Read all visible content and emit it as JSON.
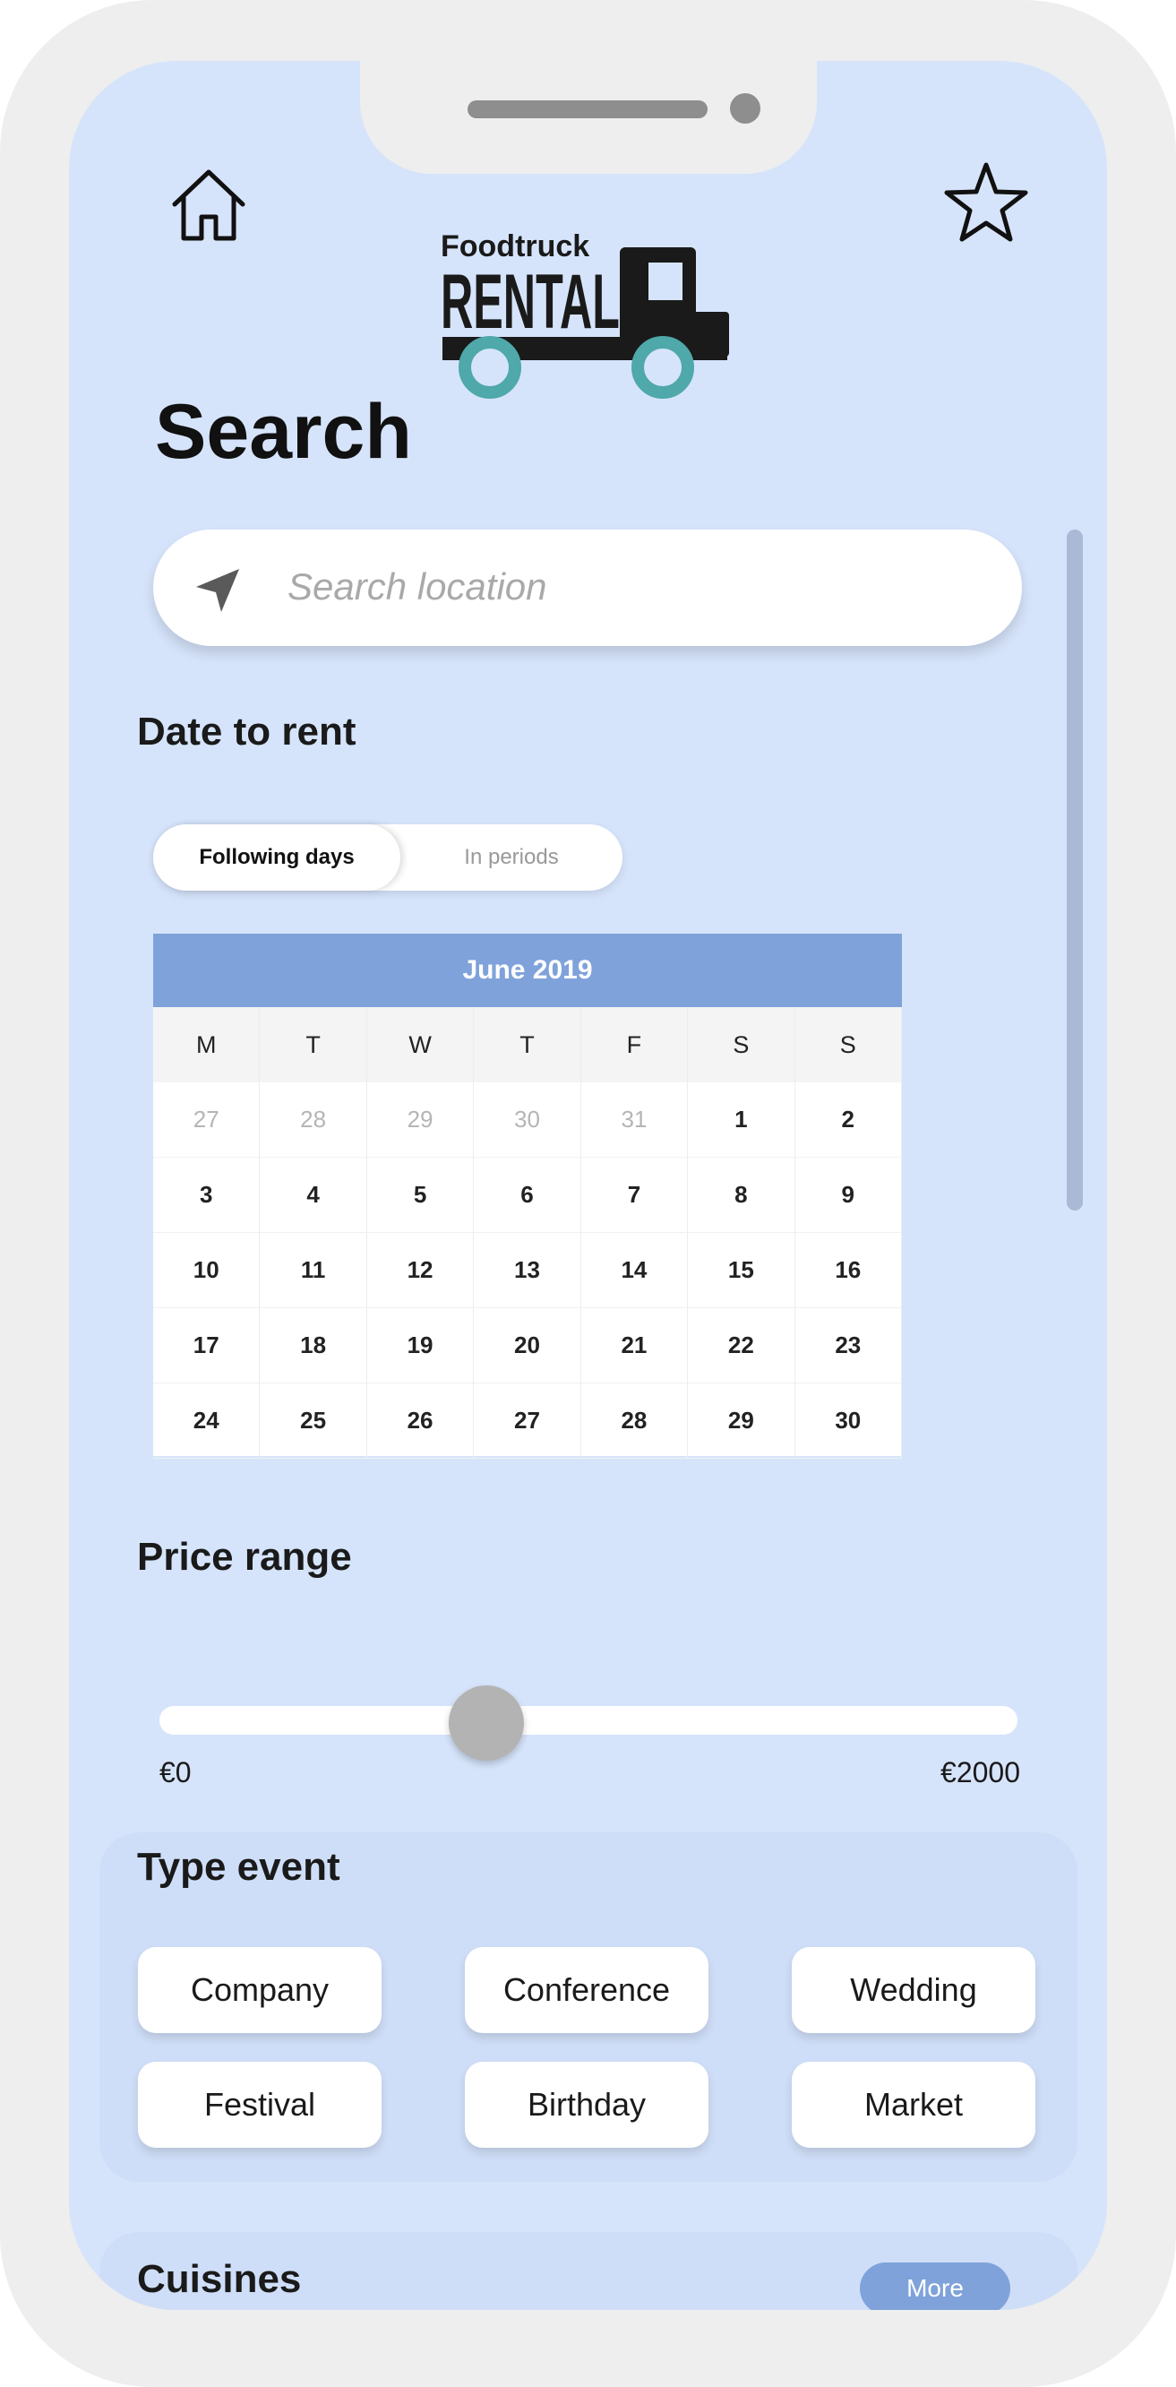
{
  "page": {
    "title": "Search"
  },
  "logo": {
    "line1": "Foodtruck",
    "line2": "RENTAL"
  },
  "header": {
    "home_icon": "home-icon",
    "favorite_icon": "star-icon"
  },
  "search": {
    "placeholder": "Search location",
    "icon": "navigation-arrow-icon"
  },
  "date_section": {
    "label": "Date to rent",
    "toggle": {
      "active": "Following days",
      "inactive": "In periods"
    }
  },
  "calendar": {
    "month": "June 2019",
    "weekdays": [
      "M",
      "T",
      "W",
      "T",
      "F",
      "S",
      "S"
    ],
    "weeks": [
      [
        {
          "d": "27",
          "muted": true
        },
        {
          "d": "28",
          "muted": true
        },
        {
          "d": "29",
          "muted": true
        },
        {
          "d": "30",
          "muted": true
        },
        {
          "d": "31",
          "muted": true
        },
        {
          "d": "1"
        },
        {
          "d": "2"
        }
      ],
      [
        {
          "d": "3"
        },
        {
          "d": "4"
        },
        {
          "d": "5"
        },
        {
          "d": "6"
        },
        {
          "d": "7"
        },
        {
          "d": "8"
        },
        {
          "d": "9"
        }
      ],
      [
        {
          "d": "10"
        },
        {
          "d": "11"
        },
        {
          "d": "12"
        },
        {
          "d": "13"
        },
        {
          "d": "14"
        },
        {
          "d": "15"
        },
        {
          "d": "16"
        }
      ],
      [
        {
          "d": "17"
        },
        {
          "d": "18"
        },
        {
          "d": "19"
        },
        {
          "d": "20"
        },
        {
          "d": "21"
        },
        {
          "d": "22"
        },
        {
          "d": "23"
        }
      ],
      [
        {
          "d": "24"
        },
        {
          "d": "25"
        },
        {
          "d": "26"
        },
        {
          "d": "27"
        },
        {
          "d": "28"
        },
        {
          "d": "29"
        },
        {
          "d": "30"
        }
      ]
    ]
  },
  "price": {
    "label": "Price range",
    "min_label": "€0",
    "max_label": "€2000",
    "min": 0,
    "max": 2000,
    "value_fraction": 0.37
  },
  "event_types": {
    "title": "Type event",
    "items": [
      "Company",
      "Conference",
      "Wedding",
      "Festival",
      "Birthday",
      "Market"
    ]
  },
  "cuisines": {
    "title": "Cuisines",
    "more_label": "More"
  },
  "colors": {
    "screen_bg": "#d6e4fb",
    "accent": "#7fa2da",
    "panel_bg": "#cfdef8",
    "frame": "#eeeeee",
    "logo_teal": "#4fa8aa"
  }
}
